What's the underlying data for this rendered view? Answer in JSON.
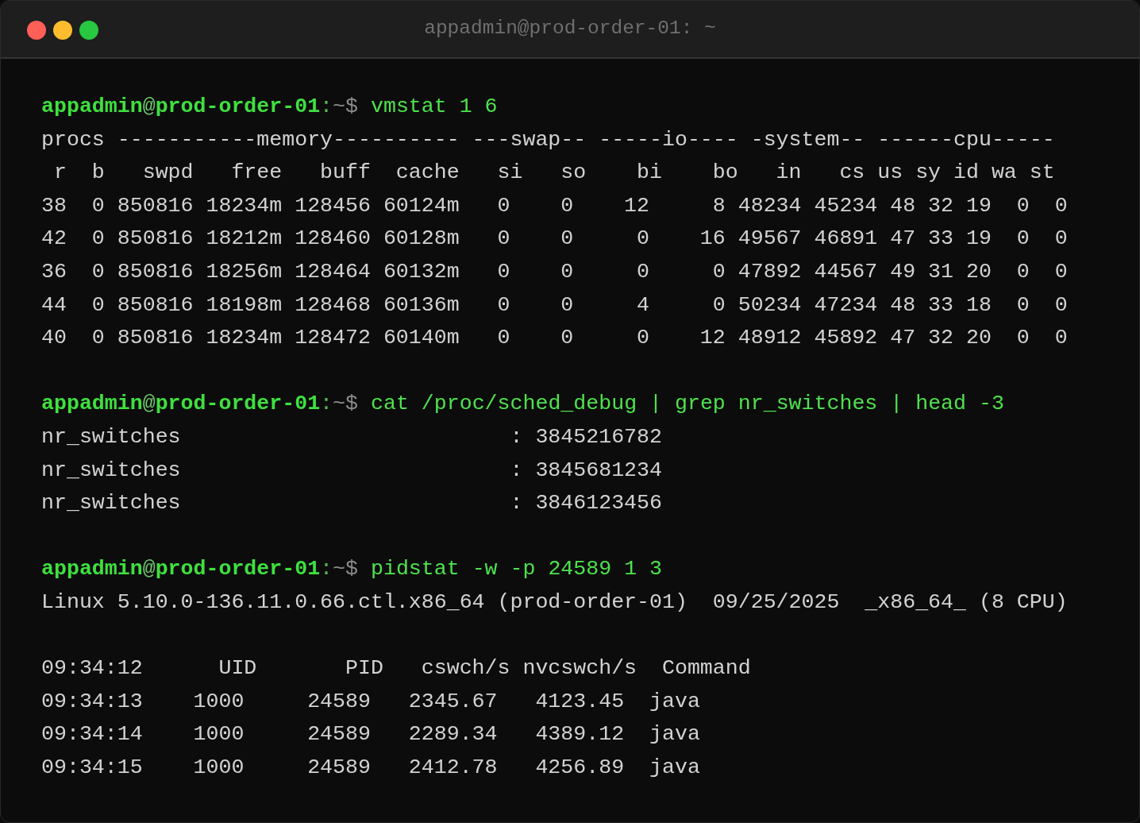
{
  "window": {
    "title": "appadmin@prod-order-01: ~"
  },
  "blocks": [
    {
      "prompt": [
        {
          "kind": "user",
          "text": "appadmin"
        },
        {
          "kind": "at",
          "text": "@"
        },
        {
          "kind": "host",
          "text": "prod-order-01"
        },
        {
          "kind": "colon",
          "text": ":"
        },
        {
          "kind": "path",
          "text": "~$"
        }
      ],
      "command": "vmstat 1 6",
      "output": [
        [
          "procs -----------memory---------- ---swap-- -----io---- -system-- ------cpu-----",
          " r  b   swpd   free   buff  cache   si   so    bi    bo   in   cs us sy id wa st",
          "38  0 850816 18234m 128456 60124m   0    0    12     8 48234 45234 48 32 19  0  0",
          "42  0 850816 18212m 128460 60128m   0    0     0    16 49567 46891 47 33 19  0  0",
          "36  0 850816 18256m 128464 60132m   0    0     0     0 47892 44567 49 31 20  0  0",
          "44  0 850816 18198m 128468 60136m   0    0     4     0 50234 47234 48 33 18  0  0",
          "40  0 850816 18234m 128472 60140m   0    0     0    12 48912 45892 47 32 20  0  0"
        ]
      ]
    },
    {
      "prompt": [
        {
          "kind": "user",
          "text": "appadmin"
        },
        {
          "kind": "at",
          "text": "@"
        },
        {
          "kind": "host",
          "text": "prod-order-01"
        },
        {
          "kind": "colon",
          "text": ":"
        },
        {
          "kind": "path",
          "text": "~$"
        }
      ],
      "command": "cat /proc/sched_debug | grep nr_switches | head -3",
      "output": [
        [
          "nr_switches                          : 3845216782",
          "nr_switches                          : 3845681234",
          "nr_switches                          : 3846123456"
        ]
      ]
    },
    {
      "prompt": [
        {
          "kind": "user",
          "text": "appadmin"
        },
        {
          "kind": "at",
          "text": "@"
        },
        {
          "kind": "host",
          "text": "prod-order-01"
        },
        {
          "kind": "colon",
          "text": ":"
        },
        {
          "kind": "path",
          "text": "~$"
        }
      ],
      "command": "pidstat -w -p 24589 1 3",
      "output": [
        [
          "Linux 5.10.0-136.11.0.66.ctl.x86_64 (prod-order-01)  09/25/2025  _x86_64_ (8 CPU)"
        ],
        [
          "09:34:12      UID       PID   cswch/s nvcswch/s  Command",
          "09:34:13    1000     24589   2345.67   4123.45  java",
          "09:34:14    1000     24589   2289.34   4389.12  java",
          "09:34:15    1000     24589   2412.78   4256.89  java"
        ]
      ]
    }
  ]
}
